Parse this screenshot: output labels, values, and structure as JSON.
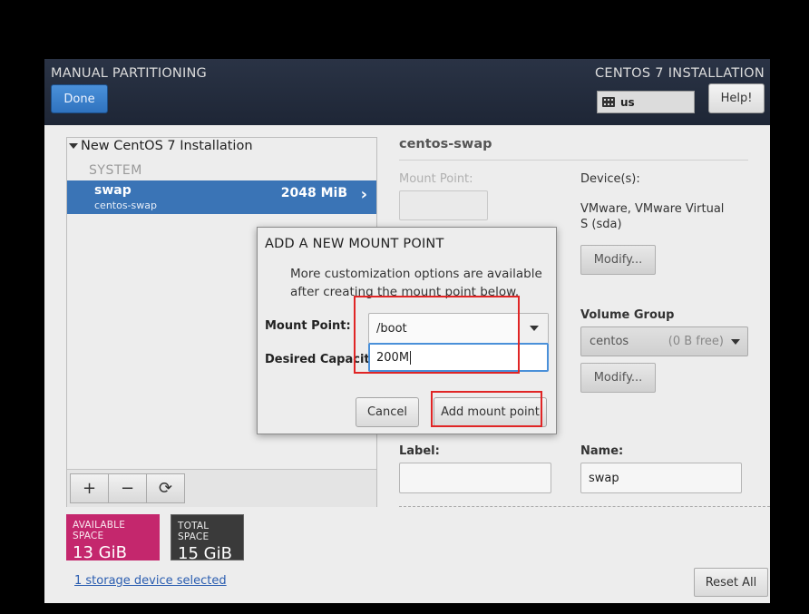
{
  "header": {
    "title": "MANUAL PARTITIONING",
    "product": "CENTOS 7 INSTALLATION",
    "done_label": "Done",
    "keyboard_layout": "us",
    "help_label": "Help!"
  },
  "tree": {
    "title": "New CentOS 7 Installation",
    "section": "SYSTEM",
    "items": [
      {
        "name": "swap",
        "sub": "centos-swap",
        "size": "2048 MiB"
      }
    ]
  },
  "toolbar": {
    "add": "+",
    "remove": "−",
    "reload": "⟳"
  },
  "space": {
    "available_label": "AVAILABLE SPACE",
    "available_value": "13 GiB",
    "total_label": "TOTAL SPACE",
    "total_value": "15 GiB"
  },
  "storage_link": "1 storage device selected",
  "detail": {
    "title": "centos-swap",
    "mount_point_label": "Mount Point:",
    "devices_label": "Device(s):",
    "devices_value": "VMware, VMware Virtual S (sda)",
    "modify_label": "Modify...",
    "volume_group_label": "Volume Group",
    "volume_group_value": "centos",
    "volume_group_free": "(0 B free)",
    "modify2_label": "Modify...",
    "label_label": "Label:",
    "name_label": "Name:",
    "name_value": "swap",
    "reset_label": "Reset All"
  },
  "dialog": {
    "title": "ADD A NEW MOUNT POINT",
    "info": "More customization options are available after creating the mount point below.",
    "mount_point_label": "Mount Point:",
    "mount_point_value": "/boot",
    "capacity_label": "Desired Capacity:",
    "capacity_value": "200M",
    "cancel_label": "Cancel",
    "add_label": "Add mount point"
  },
  "colors": {
    "header_bg": "#1e2636",
    "selection": "#3a74b6",
    "available": "#c4276d",
    "highlight": "#e02525"
  }
}
